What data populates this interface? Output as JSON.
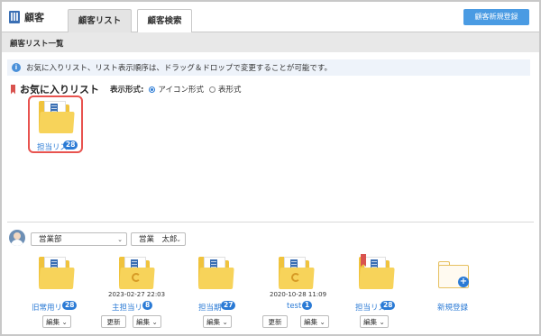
{
  "header": {
    "brand_label": "顧客",
    "tabs": [
      {
        "label": "顧客リスト",
        "active": true
      },
      {
        "label": "顧客検索",
        "active": false
      }
    ],
    "new_button": "顧客新規登録"
  },
  "section_title": "顧客リスト一覧",
  "info_text": "お気に入りリスト、リスト表示順序は、ドラッグ＆ドロップで変更することが可能です。",
  "favorites": {
    "title": "お気に入りリスト",
    "display_label": "表示形式:",
    "display_options": [
      {
        "label": "アイコン形式",
        "selected": true
      },
      {
        "label": "表形式",
        "selected": false
      }
    ],
    "items": [
      {
        "label": "担当リス",
        "badge": "28"
      }
    ]
  },
  "filter": {
    "department": "営業部",
    "person": "営業　太郎"
  },
  "lists": [
    {
      "label": "旧常用リ",
      "badge": "28",
      "timestamp": "",
      "has_update": false,
      "edit_label": "編集",
      "icon": "folder-building-icon"
    },
    {
      "label": "主担当リ",
      "badge": "8",
      "timestamp": "2023-02-27 22:03",
      "has_update": true,
      "update_label": "更新",
      "edit_label": "編集",
      "icon": "folder-sync-icon"
    },
    {
      "label": "担当期",
      "badge": "27",
      "timestamp": "",
      "has_update": false,
      "edit_label": "編集",
      "icon": "folder-building-icon"
    },
    {
      "label": "test",
      "badge": "1",
      "timestamp": "2020-10-28 11:09",
      "has_update": true,
      "update_label": "更新",
      "edit_label": "編集",
      "icon": "folder-sync-icon"
    },
    {
      "label": "担当リス",
      "badge": "28",
      "timestamp": "",
      "has_update": false,
      "edit_label": "編集",
      "icon": "folder-bookmarked-icon"
    }
  ],
  "new_list_label": "新規登録",
  "colors": {
    "accent": "#2a7ad5",
    "button": "#4a9be3",
    "folder": "#f0c33c",
    "highlight": "#e8534f"
  }
}
